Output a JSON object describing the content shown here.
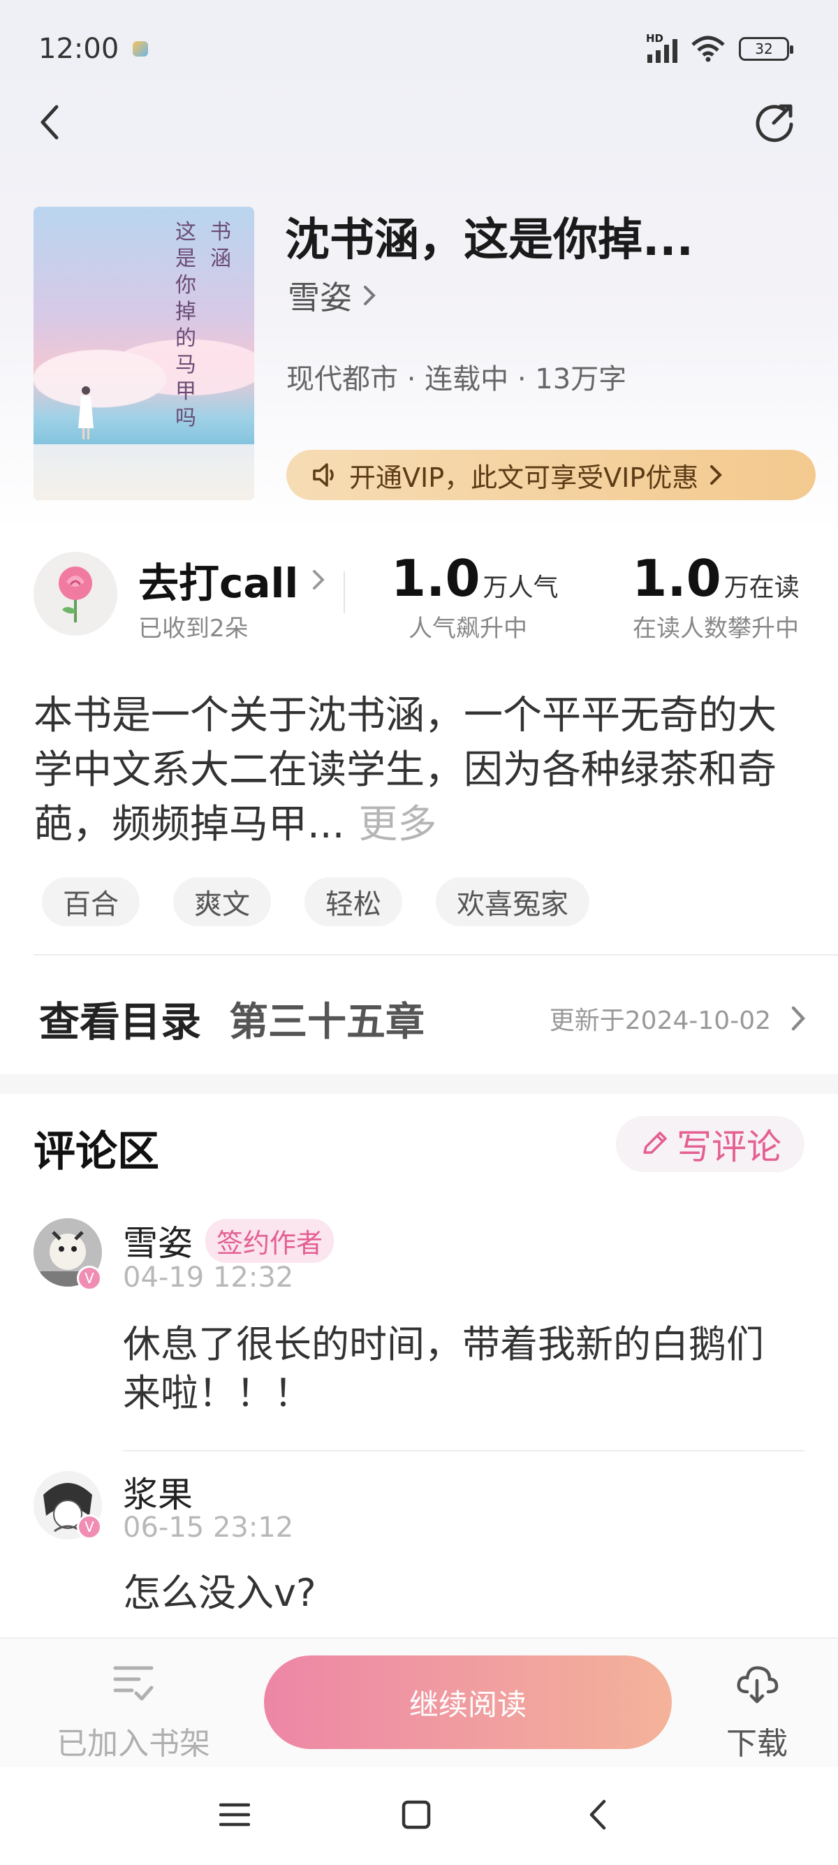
{
  "status_bar": {
    "time": "12:00",
    "network": "HD",
    "battery": "32"
  },
  "header": {
    "back_icon": "chevron-left-icon",
    "share_icon": "share-icon"
  },
  "book": {
    "cover_title_chars": [
      "书",
      "涵",
      "这",
      "是",
      "你",
      "掉",
      "的",
      "马",
      "甲",
      "吗"
    ],
    "title": "沈书涵，这是你掉...",
    "author": "雪姿",
    "meta": "现代都市 · 连载中 · 13万字",
    "vip_text": "开通VIP，此文可享受VIP优惠",
    "colors": {
      "vip_bg": "#f3c98e",
      "accent": "#e45f92"
    }
  },
  "stats": {
    "call_title": "去打call",
    "call_sub": "已收到2朵",
    "popularity_value": "1.0",
    "popularity_unit": "万人气",
    "popularity_sub": "人气飙升中",
    "readers_value": "1.0",
    "readers_unit": "万在读",
    "readers_sub": "在读人数攀升中"
  },
  "synopsis": {
    "text": "本书是一个关于沈书涵，一个平平无奇的大学中文系大二在读学生，因为各种绿茶和奇葩，频频掉马甲...",
    "more": "更多"
  },
  "tags": [
    "百合",
    "爽文",
    "轻松",
    "欢喜冤家"
  ],
  "toc": {
    "label": "查看目录",
    "chapter": "第三十五章",
    "updated": "更新于2024-10-02"
  },
  "comments_section": {
    "title": "评论区",
    "write_label": "写评论",
    "items": [
      {
        "name": "雪姿",
        "badge": "签约作者",
        "time": "04-19 12:32",
        "text": "休息了很长的时间，带着我新的白鹅们来啦！！！"
      },
      {
        "name": "浆果",
        "time": "06-15 23:12",
        "text": "怎么没入v?"
      }
    ]
  },
  "bottom": {
    "shelf_label": "已加入书架",
    "read_label": "继续阅读",
    "download_label": "下载"
  }
}
